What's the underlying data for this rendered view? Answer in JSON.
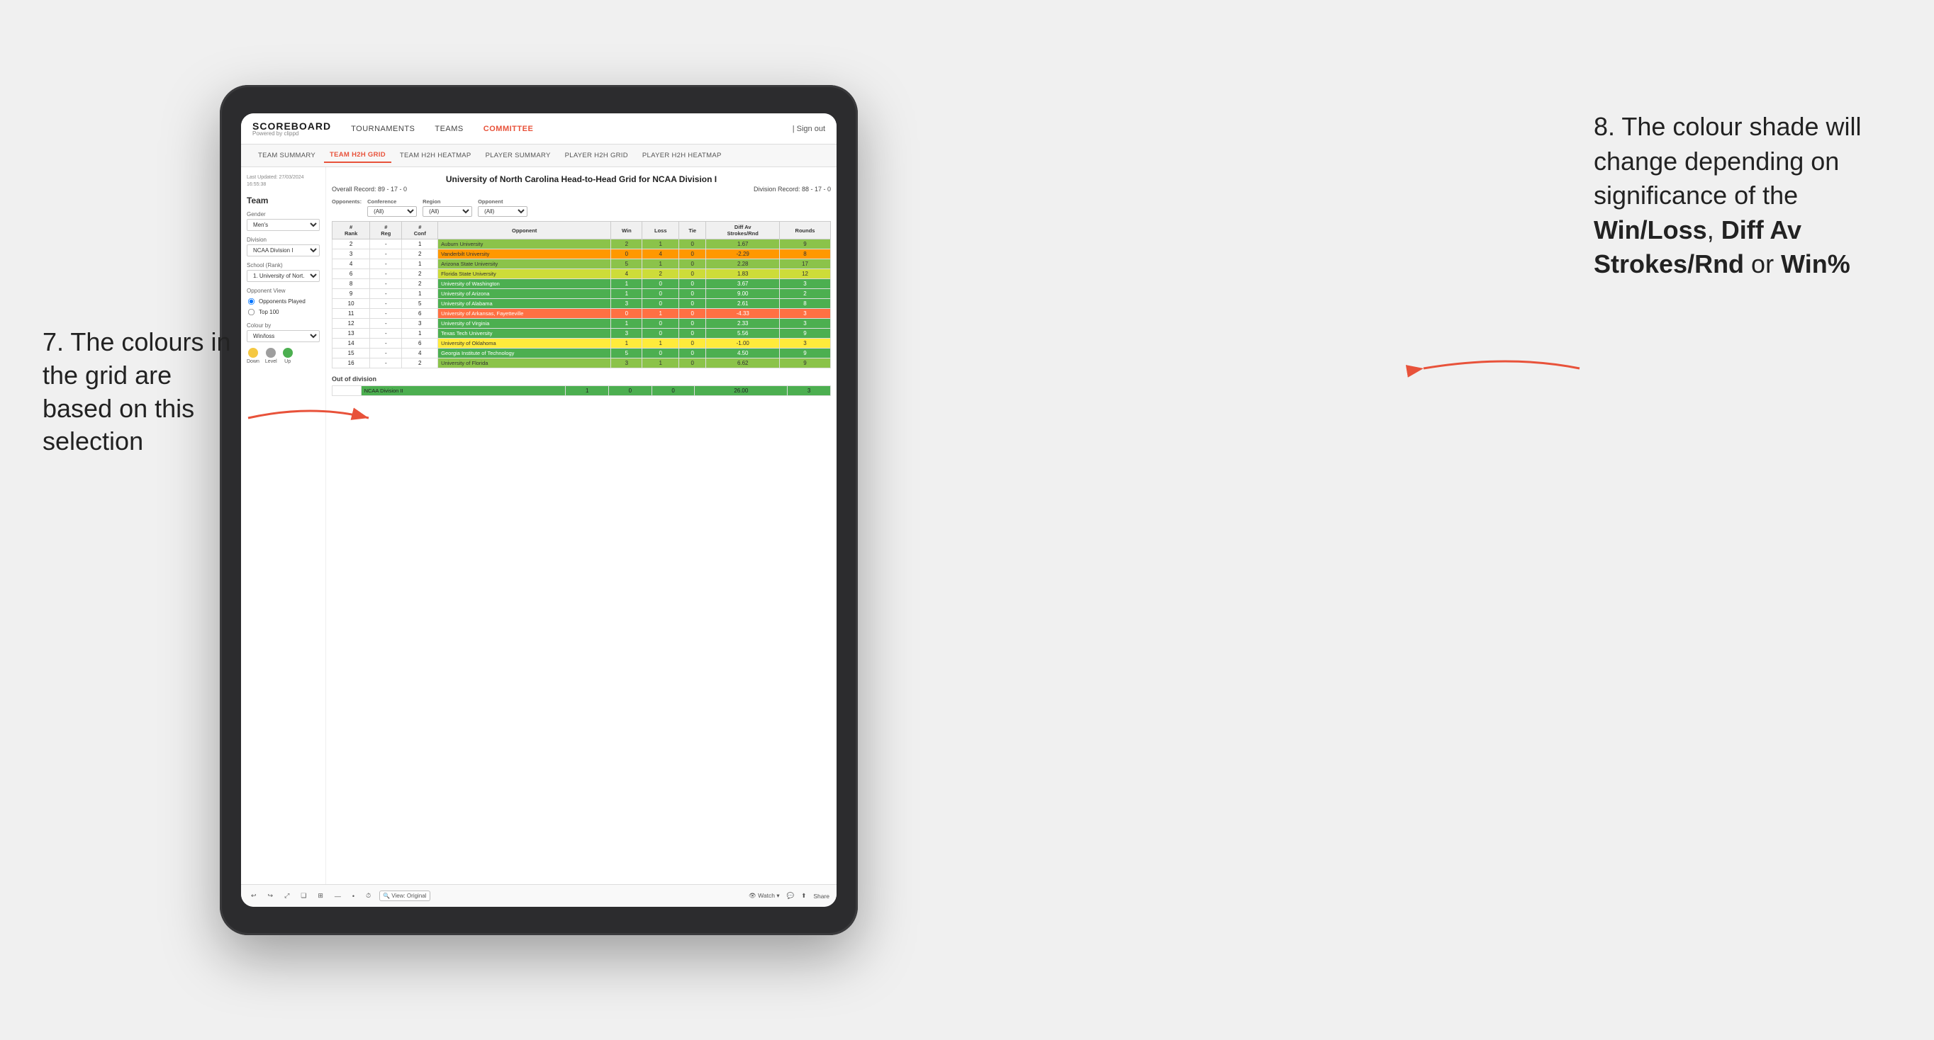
{
  "annotations": {
    "left": "7. The colours in the grid are based on this selection",
    "right_prefix": "8. The colour shade will change depending on significance of the ",
    "right_bold1": "Win/Loss",
    "right_sep1": ", ",
    "right_bold2": "Diff Av Strokes/Rnd",
    "right_sep2": " or ",
    "right_bold3": "Win%"
  },
  "app": {
    "logo": "SCOREBOARD",
    "logo_sub": "Powered by clippd",
    "sign_out": "| Sign out",
    "nav": [
      "TOURNAMENTS",
      "TEAMS",
      "COMMITTEE"
    ],
    "active_nav": "COMMITTEE",
    "sub_tabs": [
      "TEAM SUMMARY",
      "TEAM H2H GRID",
      "TEAM H2H HEATMAP",
      "PLAYER SUMMARY",
      "PLAYER H2H GRID",
      "PLAYER H2H HEATMAP"
    ],
    "active_sub_tab": "TEAM H2H GRID"
  },
  "sidebar": {
    "last_updated": "Last Updated: 27/03/2024\n16:55:38",
    "team_label": "Team",
    "gender_label": "Gender",
    "gender_value": "Men's",
    "division_label": "Division",
    "division_value": "NCAA Division I",
    "school_label": "School (Rank)",
    "school_value": "1. University of Nort...",
    "opponent_view_label": "Opponent View",
    "opponent_options": [
      "Opponents Played",
      "Top 100"
    ],
    "selected_opponent": "Opponents Played",
    "colour_by_label": "Colour by",
    "colour_by_value": "Win/loss",
    "legend_down": "Down",
    "legend_level": "Level",
    "legend_up": "Up"
  },
  "grid": {
    "title": "University of North Carolina Head-to-Head Grid for NCAA Division I",
    "overall_record": "Overall Record: 89 - 17 - 0",
    "division_record": "Division Record: 88 - 17 - 0",
    "filters": {
      "conference_label": "Conference",
      "conference_value": "(All)",
      "region_label": "Region",
      "region_value": "(All)",
      "opponent_label": "Opponent",
      "opponent_value": "(All)",
      "opponents_label": "Opponents:"
    },
    "table_headers": [
      "#\nRank",
      "#\nReg",
      "#\nConf",
      "Opponent",
      "Win",
      "Loss",
      "Tie",
      "Diff Av\nStrokes/Rnd",
      "Rounds"
    ],
    "rows": [
      {
        "rank": "2",
        "reg": "-",
        "conf": "1",
        "opponent": "Auburn University",
        "win": "2",
        "loss": "1",
        "tie": "0",
        "diff": "1.67",
        "rounds": "9",
        "color": "green-mid"
      },
      {
        "rank": "3",
        "reg": "-",
        "conf": "2",
        "opponent": "Vanderbilt University",
        "win": "0",
        "loss": "4",
        "tie": "0",
        "diff": "-2.29",
        "rounds": "8",
        "color": "orange"
      },
      {
        "rank": "4",
        "reg": "-",
        "conf": "1",
        "opponent": "Arizona State University",
        "win": "5",
        "loss": "1",
        "tie": "0",
        "diff": "2.28",
        "rounds": "17",
        "color": "green-mid"
      },
      {
        "rank": "6",
        "reg": "-",
        "conf": "2",
        "opponent": "Florida State University",
        "win": "4",
        "loss": "2",
        "tie": "0",
        "diff": "1.83",
        "rounds": "12",
        "color": "green-light"
      },
      {
        "rank": "8",
        "reg": "-",
        "conf": "2",
        "opponent": "University of Washington",
        "win": "1",
        "loss": "0",
        "tie": "0",
        "diff": "3.67",
        "rounds": "3",
        "color": "green-dark"
      },
      {
        "rank": "9",
        "reg": "-",
        "conf": "1",
        "opponent": "University of Arizona",
        "win": "1",
        "loss": "0",
        "tie": "0",
        "diff": "9.00",
        "rounds": "2",
        "color": "green-dark"
      },
      {
        "rank": "10",
        "reg": "-",
        "conf": "5",
        "opponent": "University of Alabama",
        "win": "3",
        "loss": "0",
        "tie": "0",
        "diff": "2.61",
        "rounds": "8",
        "color": "green-dark"
      },
      {
        "rank": "11",
        "reg": "-",
        "conf": "6",
        "opponent": "University of Arkansas, Fayetteville",
        "win": "0",
        "loss": "1",
        "tie": "0",
        "diff": "-4.33",
        "rounds": "3",
        "color": "red-light"
      },
      {
        "rank": "12",
        "reg": "-",
        "conf": "3",
        "opponent": "University of Virginia",
        "win": "1",
        "loss": "0",
        "tie": "0",
        "diff": "2.33",
        "rounds": "3",
        "color": "green-dark"
      },
      {
        "rank": "13",
        "reg": "-",
        "conf": "1",
        "opponent": "Texas Tech University",
        "win": "3",
        "loss": "0",
        "tie": "0",
        "diff": "5.56",
        "rounds": "9",
        "color": "green-dark"
      },
      {
        "rank": "14",
        "reg": "-",
        "conf": "6",
        "opponent": "University of Oklahoma",
        "win": "1",
        "loss": "1",
        "tie": "0",
        "diff": "-1.00",
        "rounds": "3",
        "color": "yellow"
      },
      {
        "rank": "15",
        "reg": "-",
        "conf": "4",
        "opponent": "Georgia Institute of Technology",
        "win": "5",
        "loss": "0",
        "tie": "0",
        "diff": "4.50",
        "rounds": "9",
        "color": "green-dark"
      },
      {
        "rank": "16",
        "reg": "-",
        "conf": "2",
        "opponent": "University of Florida",
        "win": "3",
        "loss": "1",
        "tie": "0",
        "diff": "6.62",
        "rounds": "9",
        "color": "green-mid"
      }
    ],
    "out_of_division_title": "Out of division",
    "out_of_division_row": {
      "division": "NCAA Division II",
      "win": "1",
      "loss": "0",
      "tie": "0",
      "diff": "26.00",
      "rounds": "3",
      "color": "green-dark"
    }
  },
  "toolbar": {
    "buttons": [
      "↩",
      "↪",
      "⤢",
      "❏",
      "⊞",
      "—",
      "•",
      "⏱"
    ],
    "view_label": "🔍 View: Original",
    "watch_label": "👁 Watch ▾",
    "comment_label": "💬",
    "share_label": "Share"
  },
  "colors": {
    "accent": "#e8523a",
    "green_dark": "#4caf50",
    "green_mid": "#8bc34a",
    "yellow": "#ffeb3b",
    "orange": "#ff9800",
    "red": "#ff7043",
    "legend_yellow": "#f5c842",
    "legend_gray": "#9e9e9e",
    "legend_green": "#4caf50"
  }
}
